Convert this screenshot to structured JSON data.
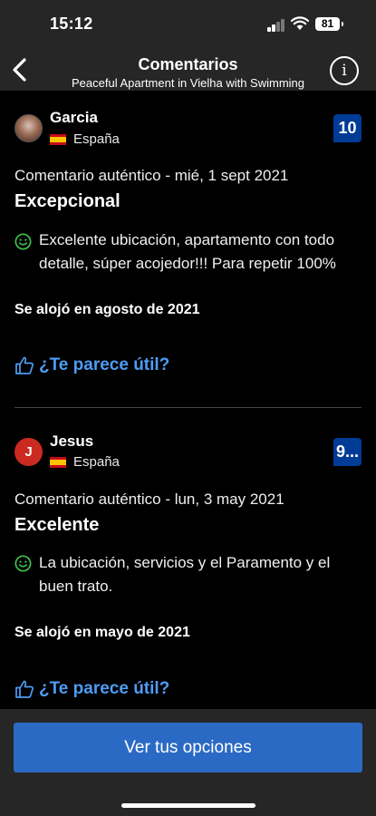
{
  "status_bar": {
    "time": "15:12",
    "battery": "81"
  },
  "nav": {
    "title": "Comentarios",
    "subtitle": "Peaceful Apartment in Vielha with Swimming",
    "back_icon": "chevron-left-icon",
    "info_icon": "info-icon",
    "info_glyph": "i"
  },
  "reviews": [
    {
      "name": "Garcia",
      "country": "España",
      "score": "10",
      "meta": "Comentario auténtico - mié, 1 sept 2021",
      "headline": "Excepcional",
      "body": "Excelente ubicación, apartamento con todo detalle, súper acojedor!!! Para repetir 100%",
      "stayed": "Se alojó en agosto de 2021",
      "helpful": "¿Te parece útil?"
    },
    {
      "name": "Jesus",
      "initial": "J",
      "country": "España",
      "score": "9...",
      "meta": "Comentario auténtico - lun, 3 may 2021",
      "headline": "Excelente",
      "body": "La ubicación, servicios y el Paramento y el buen trato.",
      "stayed": "Se alojó en mayo de 2021",
      "helpful": "¿Te parece útil?"
    }
  ],
  "footer": {
    "cta_label": "Ver tus opciones"
  },
  "colors": {
    "accent_blue": "#2b6ac4",
    "link_blue": "#4d9cf5",
    "score_bg": "#003b95",
    "positive_green": "#3fbf4a"
  }
}
